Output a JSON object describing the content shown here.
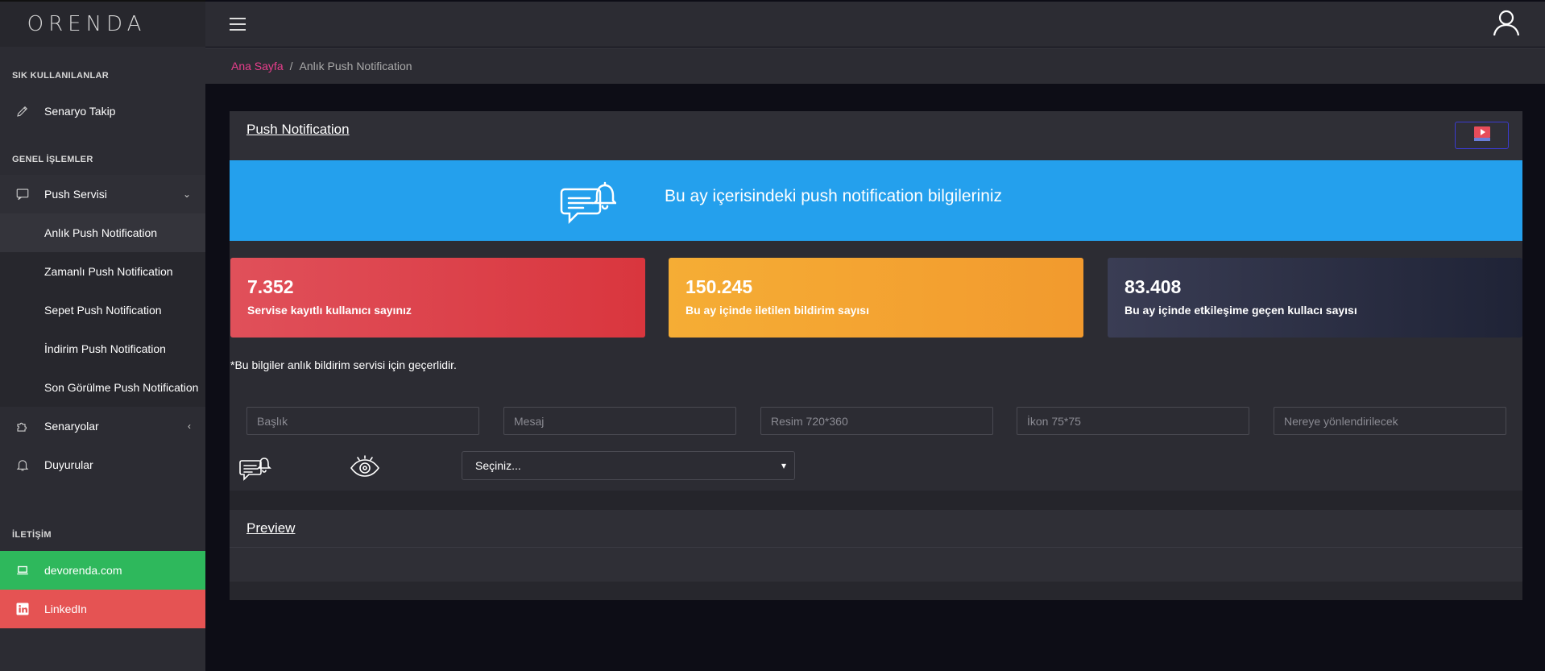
{
  "app": {
    "logo": "ORENDA"
  },
  "sidebar": {
    "section_frequent": "SIK KULLANILANLAR",
    "frequent_items": [
      {
        "label": "Senaryo Takip",
        "icon": "pencil-icon"
      }
    ],
    "section_general": "GENEL İŞLEMLER",
    "push_service": {
      "label": "Push Servisi",
      "icon": "chat-icon",
      "chevron": "chevron-down-icon"
    },
    "push_sub_items": [
      "Anlık Push Notification",
      "Zamanlı Push Notification",
      "Sepet Push Notification",
      "İndirim Push Notification",
      "Son Görülme Push Notification"
    ],
    "scenarios": {
      "label": "Senaryolar",
      "icon": "puzzle-icon",
      "chevron": "chevron-left-icon"
    },
    "announcements": {
      "label": "Duyurular",
      "icon": "bell-icon"
    },
    "section_contact": "İLETİŞİM",
    "contact_items": [
      {
        "label": "devorenda.com",
        "icon": "laptop-icon",
        "color": "#2eb85c"
      },
      {
        "label": "LinkedIn",
        "icon": "linkedin-icon",
        "color": "#e55353"
      }
    ]
  },
  "breadcrumb": {
    "home": "Ana Sayfa",
    "separator": "/",
    "current": "Anlık Push Notification"
  },
  "card": {
    "title": "Push Notification",
    "banner_text": "Bu ay içerisindeki push notification bilgileriniz",
    "banner_color": "#24a0ed"
  },
  "stats": [
    {
      "value": "7.352",
      "label": "Servise kayıtlı kullanıcı sayınız",
      "color": "#e0505a"
    },
    {
      "value": "150.245",
      "label": "Bu ay içinde iletilen bildirim sayısı",
      "color": "#f5ad35"
    },
    {
      "value": "83.408",
      "label": "Bu ay içinde etkileşime geçen kullacı sayısı",
      "color": "#2c3047"
    }
  ],
  "note": "*Bu bilgiler anlık bildirim servisi için geçerlidir.",
  "form": {
    "title_placeholder": "Başlık",
    "message_placeholder": "Mesaj",
    "image_placeholder": "Resim 720*360",
    "icon_placeholder": "İkon 75*75",
    "redirect_placeholder": "Nereye yönlendirilecek",
    "select_value": "Seçiniz..."
  },
  "preview": {
    "title": "Preview"
  }
}
